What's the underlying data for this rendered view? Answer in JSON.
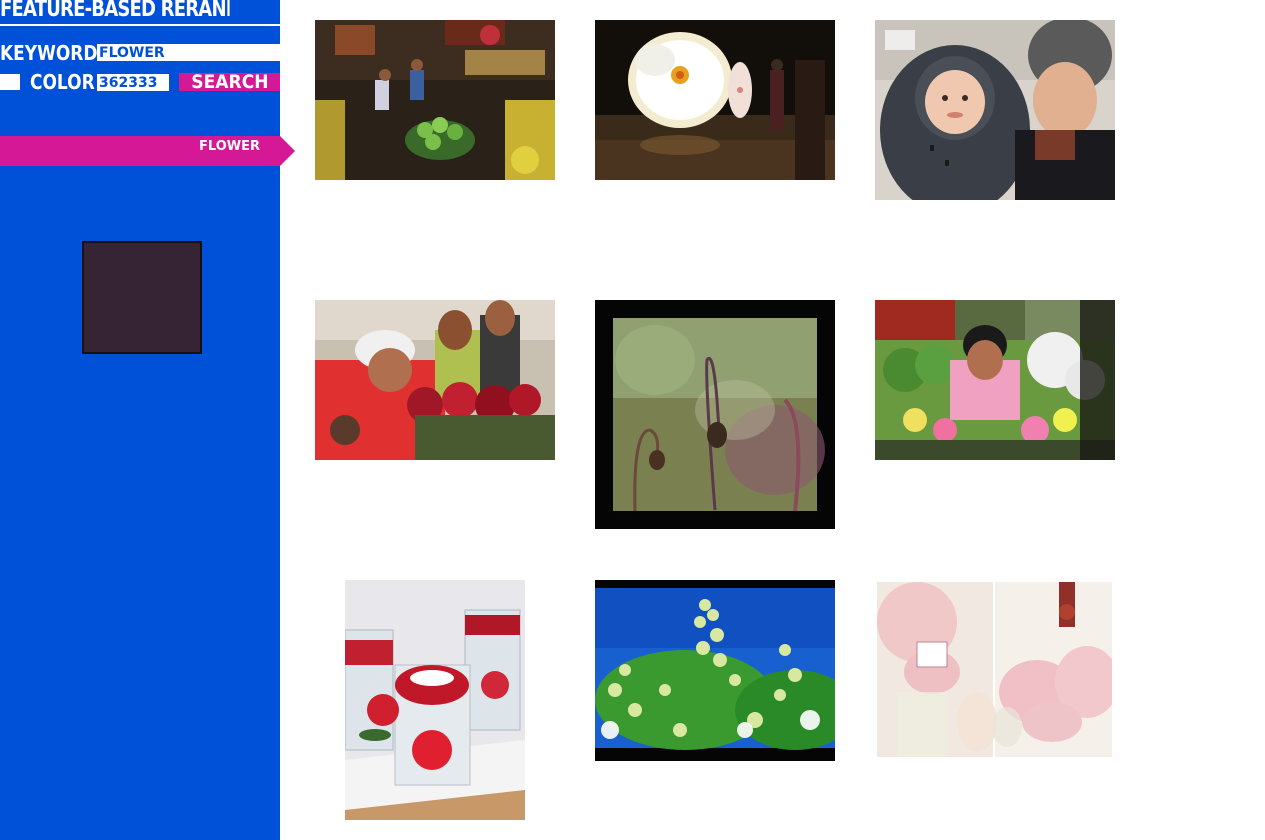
{
  "app": {
    "title": "FEATURE-BASED RERANKING"
  },
  "search": {
    "keyword_label": "KEYWORD",
    "keyword_value": "FLOWER",
    "color_label": "COLOR",
    "color_value": "362333",
    "search_button_label": "SEARCH"
  },
  "sidebar": {
    "active_keyword_tab": "FLOWER",
    "selected_color_hex": "#362333"
  },
  "colors": {
    "sidebar_bg": "#0050d8",
    "accent": "#d41896",
    "swatch": "#362333"
  },
  "results": [
    {
      "name": "result-image-night-flower-market"
    },
    {
      "name": "result-image-glowing-flower-exhibit"
    },
    {
      "name": "result-image-baby-and-father"
    },
    {
      "name": "result-image-flower-vendors"
    },
    {
      "name": "result-image-seed-pod-closeup"
    },
    {
      "name": "result-image-woman-with-flowers"
    },
    {
      "name": "result-image-rose-candle-vases"
    },
    {
      "name": "result-image-white-blossoms-blue-sky"
    },
    {
      "name": "result-image-pink-peonies"
    }
  ]
}
